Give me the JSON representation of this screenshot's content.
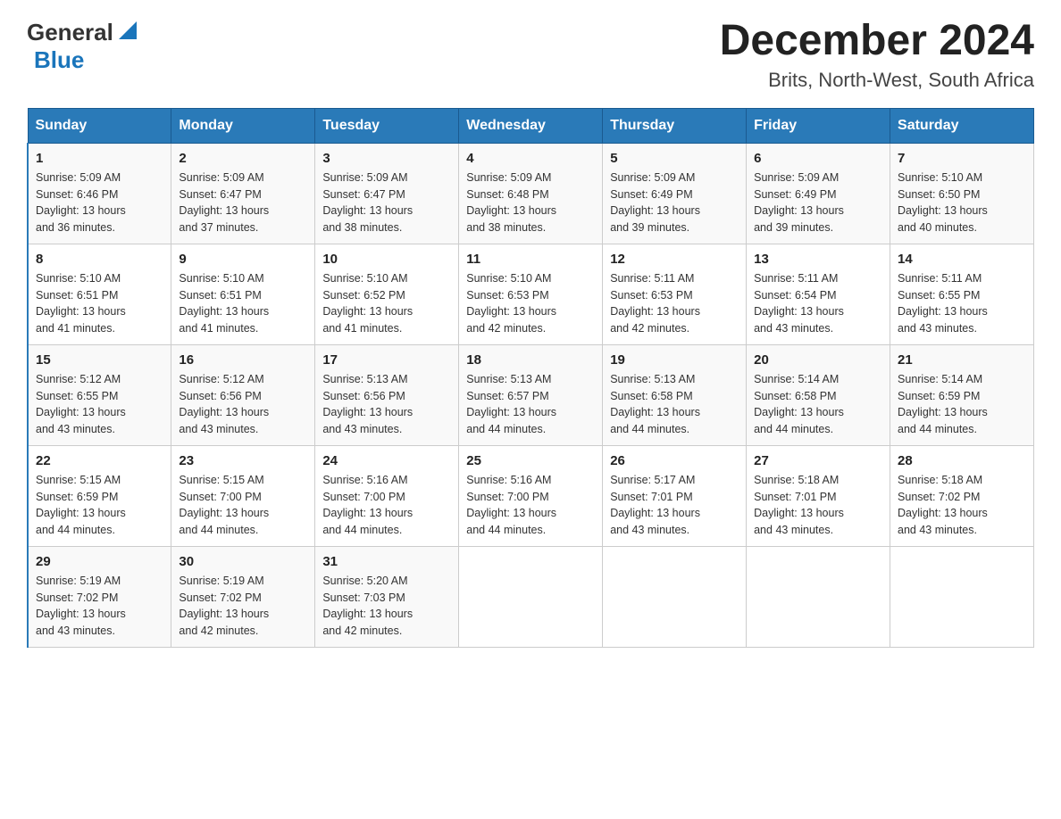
{
  "header": {
    "logo_general": "General",
    "logo_blue": "Blue",
    "title": "December 2024",
    "subtitle": "Brits, North-West, South Africa"
  },
  "days_of_week": [
    "Sunday",
    "Monday",
    "Tuesday",
    "Wednesday",
    "Thursday",
    "Friday",
    "Saturday"
  ],
  "weeks": [
    [
      {
        "day": "1",
        "sunrise": "5:09 AM",
        "sunset": "6:46 PM",
        "daylight": "13 hours and 36 minutes."
      },
      {
        "day": "2",
        "sunrise": "5:09 AM",
        "sunset": "6:47 PM",
        "daylight": "13 hours and 37 minutes."
      },
      {
        "day": "3",
        "sunrise": "5:09 AM",
        "sunset": "6:47 PM",
        "daylight": "13 hours and 38 minutes."
      },
      {
        "day": "4",
        "sunrise": "5:09 AM",
        "sunset": "6:48 PM",
        "daylight": "13 hours and 38 minutes."
      },
      {
        "day": "5",
        "sunrise": "5:09 AM",
        "sunset": "6:49 PM",
        "daylight": "13 hours and 39 minutes."
      },
      {
        "day": "6",
        "sunrise": "5:09 AM",
        "sunset": "6:49 PM",
        "daylight": "13 hours and 39 minutes."
      },
      {
        "day": "7",
        "sunrise": "5:10 AM",
        "sunset": "6:50 PM",
        "daylight": "13 hours and 40 minutes."
      }
    ],
    [
      {
        "day": "8",
        "sunrise": "5:10 AM",
        "sunset": "6:51 PM",
        "daylight": "13 hours and 41 minutes."
      },
      {
        "day": "9",
        "sunrise": "5:10 AM",
        "sunset": "6:51 PM",
        "daylight": "13 hours and 41 minutes."
      },
      {
        "day": "10",
        "sunrise": "5:10 AM",
        "sunset": "6:52 PM",
        "daylight": "13 hours and 41 minutes."
      },
      {
        "day": "11",
        "sunrise": "5:10 AM",
        "sunset": "6:53 PM",
        "daylight": "13 hours and 42 minutes."
      },
      {
        "day": "12",
        "sunrise": "5:11 AM",
        "sunset": "6:53 PM",
        "daylight": "13 hours and 42 minutes."
      },
      {
        "day": "13",
        "sunrise": "5:11 AM",
        "sunset": "6:54 PM",
        "daylight": "13 hours and 43 minutes."
      },
      {
        "day": "14",
        "sunrise": "5:11 AM",
        "sunset": "6:55 PM",
        "daylight": "13 hours and 43 minutes."
      }
    ],
    [
      {
        "day": "15",
        "sunrise": "5:12 AM",
        "sunset": "6:55 PM",
        "daylight": "13 hours and 43 minutes."
      },
      {
        "day": "16",
        "sunrise": "5:12 AM",
        "sunset": "6:56 PM",
        "daylight": "13 hours and 43 minutes."
      },
      {
        "day": "17",
        "sunrise": "5:13 AM",
        "sunset": "6:56 PM",
        "daylight": "13 hours and 43 minutes."
      },
      {
        "day": "18",
        "sunrise": "5:13 AM",
        "sunset": "6:57 PM",
        "daylight": "13 hours and 44 minutes."
      },
      {
        "day": "19",
        "sunrise": "5:13 AM",
        "sunset": "6:58 PM",
        "daylight": "13 hours and 44 minutes."
      },
      {
        "day": "20",
        "sunrise": "5:14 AM",
        "sunset": "6:58 PM",
        "daylight": "13 hours and 44 minutes."
      },
      {
        "day": "21",
        "sunrise": "5:14 AM",
        "sunset": "6:59 PM",
        "daylight": "13 hours and 44 minutes."
      }
    ],
    [
      {
        "day": "22",
        "sunrise": "5:15 AM",
        "sunset": "6:59 PM",
        "daylight": "13 hours and 44 minutes."
      },
      {
        "day": "23",
        "sunrise": "5:15 AM",
        "sunset": "7:00 PM",
        "daylight": "13 hours and 44 minutes."
      },
      {
        "day": "24",
        "sunrise": "5:16 AM",
        "sunset": "7:00 PM",
        "daylight": "13 hours and 44 minutes."
      },
      {
        "day": "25",
        "sunrise": "5:16 AM",
        "sunset": "7:00 PM",
        "daylight": "13 hours and 44 minutes."
      },
      {
        "day": "26",
        "sunrise": "5:17 AM",
        "sunset": "7:01 PM",
        "daylight": "13 hours and 43 minutes."
      },
      {
        "day": "27",
        "sunrise": "5:18 AM",
        "sunset": "7:01 PM",
        "daylight": "13 hours and 43 minutes."
      },
      {
        "day": "28",
        "sunrise": "5:18 AM",
        "sunset": "7:02 PM",
        "daylight": "13 hours and 43 minutes."
      }
    ],
    [
      {
        "day": "29",
        "sunrise": "5:19 AM",
        "sunset": "7:02 PM",
        "daylight": "13 hours and 43 minutes."
      },
      {
        "day": "30",
        "sunrise": "5:19 AM",
        "sunset": "7:02 PM",
        "daylight": "13 hours and 42 minutes."
      },
      {
        "day": "31",
        "sunrise": "5:20 AM",
        "sunset": "7:03 PM",
        "daylight": "13 hours and 42 minutes."
      },
      null,
      null,
      null,
      null
    ]
  ],
  "labels": {
    "sunrise": "Sunrise:",
    "sunset": "Sunset:",
    "daylight": "Daylight:"
  }
}
